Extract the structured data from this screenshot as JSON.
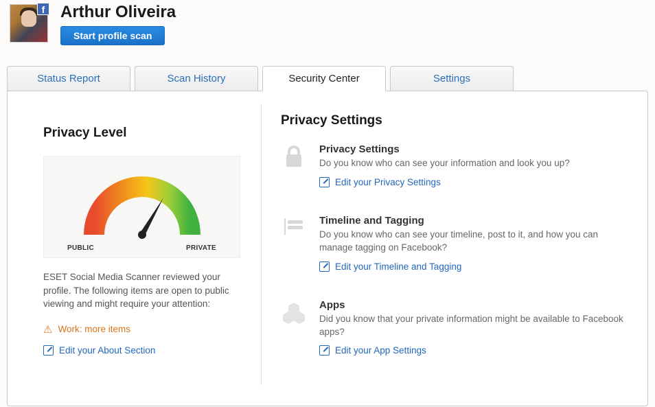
{
  "profile": {
    "name": "Arthur Oliveira",
    "scan_button": "Start profile scan"
  },
  "tabs": [
    {
      "label": "Status Report"
    },
    {
      "label": "Scan History"
    },
    {
      "label": "Security Center"
    },
    {
      "label": "Settings"
    }
  ],
  "active_tab": 2,
  "privacy_level": {
    "title": "Privacy Level",
    "gauge": {
      "left_label": "PUBLIC",
      "right_label": "PRIVATE",
      "needle_angle_deg": 30
    },
    "review_text": "ESET Social Media Scanner reviewed your profile. The following items are open to public viewing and might require your attention:",
    "warning_link": "Work: more items",
    "edit_link": "Edit your About Section"
  },
  "privacy_settings": {
    "title": "Privacy Settings",
    "items": [
      {
        "icon": "lock",
        "title": "Privacy Settings",
        "desc": "Do you know who can see your information and look you up?",
        "link": "Edit your Privacy Settings"
      },
      {
        "icon": "timeline",
        "title": "Timeline and Tagging",
        "desc": "Do you know who can see your timeline, post to it, and how you can manage tagging on Facebook?",
        "link": "Edit your Timeline and Tagging"
      },
      {
        "icon": "apps",
        "title": "Apps",
        "desc": "Did you know that your private information might be available to Facebook apps?",
        "link": "Edit your App Settings"
      }
    ]
  }
}
